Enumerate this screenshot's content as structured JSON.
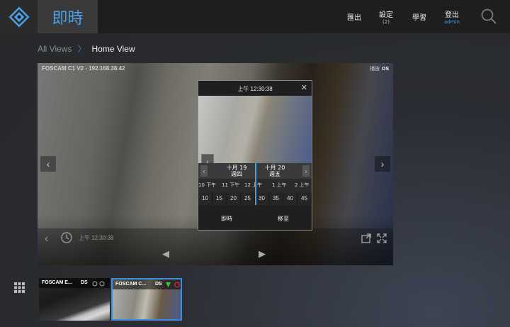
{
  "header": {
    "title": "即時",
    "nav": [
      {
        "label": "匯出",
        "sub": ""
      },
      {
        "label": "設定",
        "sub": "(2)"
      },
      {
        "label": "學習",
        "sub": ""
      },
      {
        "label": "登出",
        "sub": "admin"
      }
    ]
  },
  "breadcrumb": {
    "root": "All Views",
    "current": "Home View"
  },
  "view": {
    "camera_label": "FOSCAM C1 V2 - 192.168.38.42",
    "status": "播放",
    "ds": "DS",
    "timestamp": "上午 12:30:38"
  },
  "popup": {
    "title": "上午 12:30:38",
    "dates": [
      {
        "date": "十月 19",
        "weekday": "週四"
      },
      {
        "date": "十月 20",
        "weekday": "週五"
      }
    ],
    "hours": [
      "10 下午",
      "11 下午",
      "12 上午",
      "1 上午",
      "2 上午"
    ],
    "minutes": [
      "10",
      "15",
      "20",
      "25",
      "30",
      "35",
      "40",
      "45"
    ],
    "buttons": {
      "live": "即時",
      "goto": "移至"
    }
  },
  "thumbnails": [
    {
      "label": "FOSCAM E...",
      "ds": "DS"
    },
    {
      "label": "FOSCAM C...",
      "ds": "DS"
    }
  ],
  "colors": {
    "accent": "#4aa0e8",
    "topbar": "#1e1e1e",
    "selected": "#3a8ee0"
  }
}
